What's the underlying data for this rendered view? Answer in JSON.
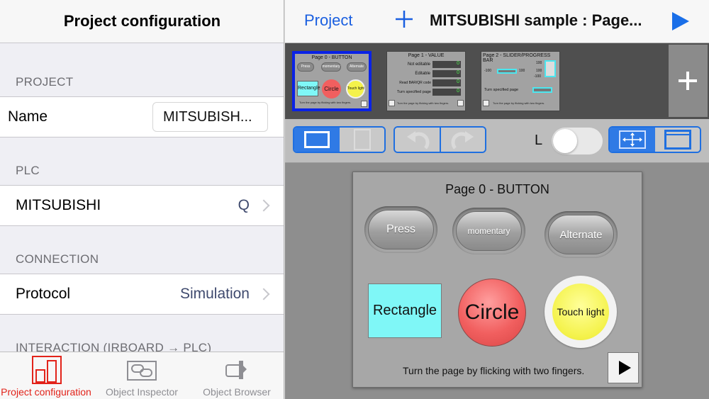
{
  "left": {
    "header_title": "Project configuration",
    "sections": {
      "project": "PROJECT",
      "plc": "PLC",
      "connection": "CONNECTION",
      "interaction": "INTERACTION (IRBOARD → PLC)"
    },
    "name_row": {
      "label": "Name",
      "value": "MITSUBISH..."
    },
    "plc_row": {
      "label": "MITSUBISHI",
      "value": "Q"
    },
    "protocol_row": {
      "label": "Protocol",
      "value": "Simulation"
    },
    "tabs": [
      {
        "label": "Project configuration",
        "icon": "project-config-icon",
        "active": true
      },
      {
        "label": "Object Inspector",
        "icon": "object-inspector-icon",
        "active": false
      },
      {
        "label": "Object Browser",
        "icon": "object-browser-icon",
        "active": false
      }
    ]
  },
  "nav": {
    "back_label": "Project",
    "title": "MITSUBISHI sample : Page...",
    "accent_color": "#1a5fe0"
  },
  "thumbnails": [
    {
      "title": "Page 0 - BUTTON",
      "selected": true,
      "buttons": [
        "Press",
        "momentary",
        "Alternate"
      ],
      "shapes": [
        "Rectangle",
        "Circle",
        "Touch light"
      ],
      "hint": "Turn the page by flicking with two fingers."
    },
    {
      "title": "Page 1 - VALUE",
      "selected": false,
      "rows": [
        {
          "label": "Not editable",
          "value": "0"
        },
        {
          "label": "Editable",
          "value": "0"
        },
        {
          "label": "Read BAR/QR code",
          "value": "0"
        },
        {
          "label": "Turn specified page",
          "value": "0"
        }
      ],
      "hint": "Turn the page by flicking with two fingers."
    },
    {
      "title": "Page 2 - SLIDER/PROGRESS BAR",
      "selected": false,
      "ticks": [
        "100",
        "-100",
        "100",
        "100",
        "-100"
      ],
      "turn_label": "Turn specified page",
      "hint": "Turn the page by flicking with two fingers."
    }
  ],
  "toolbar": {
    "layout_label": "L",
    "toggle_on": false
  },
  "page": {
    "title": "Page 0 - BUTTON",
    "buttons": [
      "Press",
      "momentary",
      "Alternate"
    ],
    "rectangle_label": "Rectangle",
    "circle_label": "Circle",
    "touch_light_label": "Touch light",
    "hint": "Turn the page by flicking with two fingers.",
    "colors": {
      "rectangle": "#7ff7f7",
      "circle": "#f15f5f",
      "touch_light": "#f4f24a"
    }
  }
}
